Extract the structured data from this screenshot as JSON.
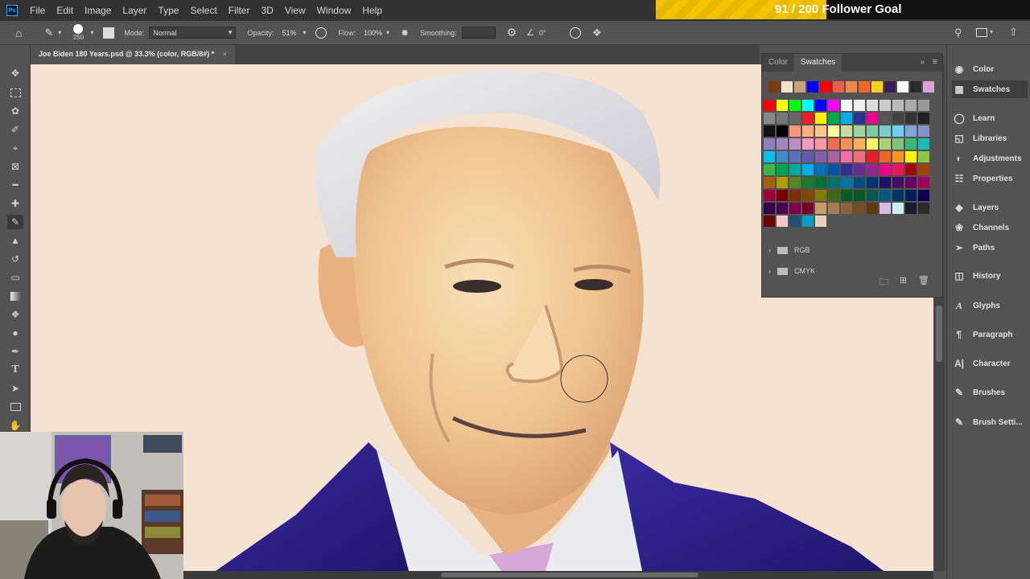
{
  "app": {
    "logo": "Ps"
  },
  "menu": [
    "File",
    "Edit",
    "Image",
    "Layer",
    "Type",
    "Select",
    "Filter",
    "3D",
    "View",
    "Window",
    "Help"
  ],
  "goal": {
    "text": "91 / 200 Follower Goal",
    "progress": 0.455,
    "color": "#f5c400"
  },
  "options": {
    "brush_size": "250",
    "mode_label": "Mode:",
    "mode_value": "Normal",
    "opacity_label": "Opacity:",
    "opacity_value": "51%",
    "flow_label": "Flow:",
    "flow_value": "100%",
    "smoothing_label": "Smoothing:",
    "angle_value": "0°"
  },
  "document": {
    "tab_title": "Joe Biden 180 Years.psd @ 33.3% (color, RGB/8#) *",
    "close": "×"
  },
  "swatches_panel": {
    "tabs": [
      "Color",
      "Swatches"
    ],
    "active_tab": "Swatches",
    "recent_colors": [
      "#7a3a10",
      "#f5e4c8",
      "#c8a27a",
      "#0000ff",
      "#ff0000",
      "#e8604c",
      "#f08a4b",
      "#f26522",
      "#f7d117",
      "#3d1a5a",
      "#ffffff",
      "#2a2a2a",
      "#d9a3d9"
    ],
    "grid_colors": [
      "#ff0000",
      "#ffff00",
      "#00ff00",
      "#00ffff",
      "#0000ff",
      "#ff00ff",
      "#ffffff",
      "#eeeeee",
      "#dddddd",
      "#cccccc",
      "#bbbbbb",
      "#aaaaaa",
      "#999999",
      "#888888",
      "#777777",
      "#666666",
      "#ee1c24",
      "#fff200",
      "#00a651",
      "#00aeef",
      "#2e3192",
      "#ec008c",
      "#555555",
      "#444444",
      "#333333",
      "#222222",
      "#111111",
      "#000000",
      "#f7977a",
      "#f9ad81",
      "#fdc68a",
      "#fff79a",
      "#c4df9b",
      "#a3d39c",
      "#82ca9d",
      "#7bcdc8",
      "#6ecff6",
      "#7ea7d8",
      "#8493ca",
      "#8882be",
      "#a187be",
      "#bc8dbf",
      "#f49ac2",
      "#f6989d",
      "#f26c4f",
      "#f68e55",
      "#fbaf5c",
      "#fff467",
      "#acd372",
      "#7cc576",
      "#3bb878",
      "#1abbb4",
      "#00bff3",
      "#438ccb",
      "#5574b9",
      "#605ca8",
      "#855fa8",
      "#a763a8",
      "#f06ea9",
      "#f26d7d",
      "#ed1c24",
      "#f26522",
      "#f7941d",
      "#fff200",
      "#8dc63f",
      "#39b54a",
      "#00a651",
      "#00a99d",
      "#00aeef",
      "#0072bc",
      "#0054a6",
      "#2e3192",
      "#662d91",
      "#92278f",
      "#ec008c",
      "#ed145b",
      "#9e0b0f",
      "#a0410d",
      "#a3620a",
      "#aba000",
      "#598527",
      "#1a7b30",
      "#007236",
      "#00746b",
      "#0076a3",
      "#004b80",
      "#003471",
      "#1b1464",
      "#440e62",
      "#630460",
      "#9e005d",
      "#9e0039",
      "#790000",
      "#7b2e00",
      "#7d4900",
      "#827b00",
      "#406618",
      "#005e20",
      "#005826",
      "#005952",
      "#005b7f",
      "#003663",
      "#002157",
      "#0d004c",
      "#32004b",
      "#4b0049",
      "#7b0046",
      "#7a0026",
      "#c69c6d",
      "#a67c52",
      "#8c6239",
      "#754c24",
      "#603913",
      "#d6b9e6",
      "#c7f0f0",
      "#1a1a2e",
      "#2b2b2b",
      "#6b0000",
      "#f7c6c6",
      "#1f4e79",
      "#00a0c6",
      "#e8d0b8"
    ],
    "folders": [
      "RGB",
      "CMYK"
    ]
  },
  "dock": {
    "items": [
      "Color",
      "Swatches",
      "Learn",
      "Libraries",
      "Adjustments",
      "Properties",
      "Layers",
      "Channels",
      "Paths",
      "History",
      "Glyphs",
      "Paragraph",
      "Character",
      "Brushes",
      "Brush Setti..."
    ],
    "active": "Swatches"
  },
  "canvas": {
    "background": "#f4e3d0",
    "suit_color": "#2a1f8a",
    "skin_color": "#f2c08a",
    "hair_color": "#e3e3e6"
  }
}
